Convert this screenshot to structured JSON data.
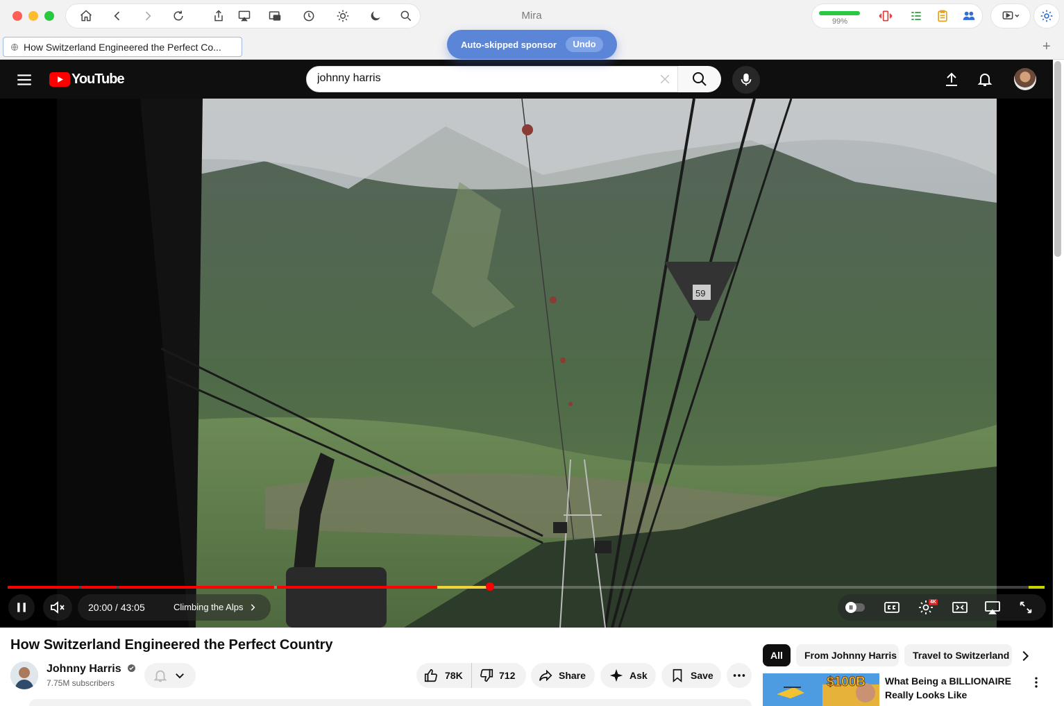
{
  "browser": {
    "app_title": "Mira",
    "battery": "99%",
    "battery_level": 0.99,
    "tab_title": "How Switzerland Engineered the Perfect Co...",
    "new_tab": "+"
  },
  "toast": {
    "message": "Auto-skipped sponsor",
    "undo": "Undo"
  },
  "youtube": {
    "logo_text": "YouTube",
    "search_value": "johnny harris"
  },
  "player": {
    "time": "20:00 / 43:05",
    "chapter": "Climbing the Alps",
    "settings_badge": "4K",
    "frame_number": "59",
    "progress": 0.4649
  },
  "video": {
    "title": "How Switzerland Engineered the Perfect Country",
    "channel": "Johnny Harris",
    "subscribers": "7.75M subscribers",
    "likes": "78K",
    "dislikes": "712",
    "share": "Share",
    "ask": "Ask",
    "save": "Save"
  },
  "sidebar": {
    "chips": [
      "All",
      "From Johnny Harris",
      "Travel to Switzerland"
    ],
    "rec_title": "What Being a BILLIONAIRE Really Looks Like",
    "rec_thumb_text": "$100B"
  },
  "colors": {
    "accent_red": "#ff0000",
    "sponsor_yellow": "#f0d23c",
    "toast_blue": "#5b86d8"
  }
}
